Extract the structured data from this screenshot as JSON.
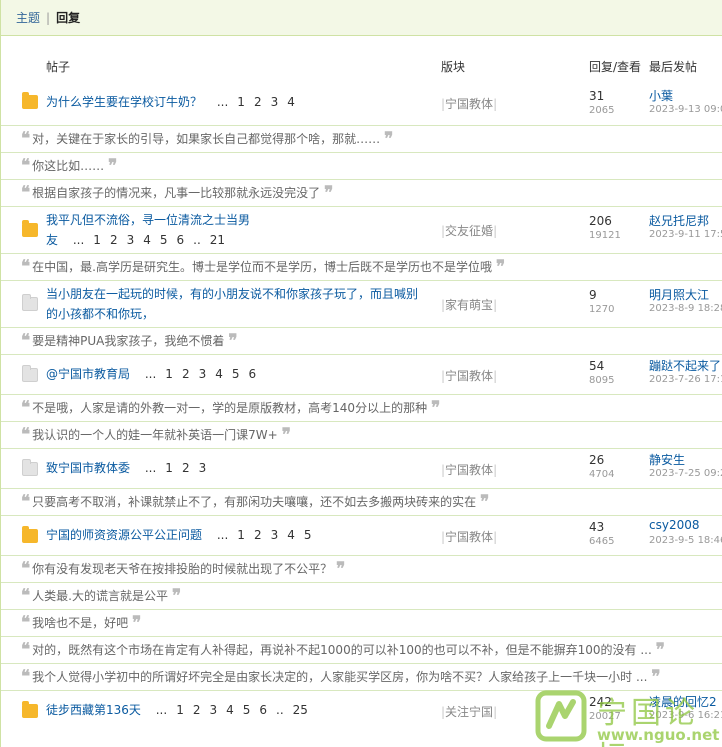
{
  "tabs": [
    {
      "label": "主题"
    },
    {
      "label": "回复"
    }
  ],
  "columns": {
    "post": "帖子",
    "forum": "版块",
    "replies_views": "回复/查看",
    "last_post": "最后发帖"
  },
  "threads": [
    {
      "title": "为什么学生要在学校订牛奶？",
      "ellipsis": "...",
      "pages": [
        "1",
        "2",
        "3",
        "4"
      ],
      "forum": "宁国教体",
      "replies": "31",
      "views": "2065",
      "last_user": "小葉",
      "last_date": "2023-9-13 09:0",
      "icon": "hot",
      "quotes": [
        "对，关键在于家长的引导，如果家长自己都觉得那个啥，那就……",
        "你这比如……",
        "根据自家孩子的情况来，凡事一比较那就永远没完没了"
      ]
    },
    {
      "title": "我平凡但不流俗，寻一位清流之士当男友",
      "title_line1": "我平凡但不流俗，寻一位清流之士当男",
      "title_line2": "友",
      "ellipsis": "...",
      "pages": [
        "1",
        "2",
        "3",
        "4",
        "5",
        "6",
        "..",
        "21"
      ],
      "forum": "交友征婚",
      "replies": "206",
      "views": "19121",
      "last_user": "赵兄托尼邦",
      "last_date": "2023-9-11 17:5",
      "icon": "hot",
      "quotes": [
        "在中国，最.高学历是研究生。博士是学位而不是学历，博士后既不是学历也不是学位哦"
      ]
    },
    {
      "title_line1": "当小朋友在一起玩的时候，有的小朋友说不和你家孩子玩了，而且喊别",
      "title_line2": "的小孩都不和你玩，",
      "forum": "家有萌宝",
      "replies": "9",
      "views": "1270",
      "last_user": "明月照大江",
      "last_date": "2023-8-9 18:28",
      "icon": "cold",
      "quotes": [
        "要是精神PUA我家孩子，我绝不惯着"
      ]
    },
    {
      "title": "@宁国市教育局",
      "ellipsis": "...",
      "pages": [
        "1",
        "2",
        "3",
        "4",
        "5",
        "6"
      ],
      "forum": "宁国教体",
      "replies": "54",
      "views": "8095",
      "last_user": "蹦跶不起来了",
      "last_date": "2023-7-26 17:1",
      "icon": "cold",
      "quotes": [
        "不是哦，人家是请的外教一对一，学的是原版教材，高考140分以上的那种",
        "我认识的一个人的娃一年就补英语一门课7W+"
      ]
    },
    {
      "title": "致宁国市教体委",
      "ellipsis": "...",
      "pages": [
        "1",
        "2",
        "3"
      ],
      "forum": "宁国教体",
      "replies": "26",
      "views": "4704",
      "last_user": "静安生",
      "last_date": "2023-7-25 09:2",
      "icon": "cold",
      "quotes": [
        "只要高考不取消，补课就禁止不了，有那闲功夫嚷嚷，还不如去多搬两块砖来的实在"
      ]
    },
    {
      "title": "宁国的师资资源公平公正问题",
      "ellipsis": "...",
      "pages": [
        "1",
        "2",
        "3",
        "4",
        "5"
      ],
      "forum": "宁国教体",
      "replies": "43",
      "views": "6465",
      "last_user": "csy2008",
      "last_date": "2023-9-5 18:46",
      "icon": "hot",
      "quotes": [
        "你有没有发现老天爷在按排投胎的时候就出现了不公平？",
        "人类最.大的谎言就是公平",
        "我啥也不是，好吧",
        "对的，既然有这个市场在肯定有人补得起，再说补不起1000的可以补100的也可以不补，但是不能摒弃100的没有 ...",
        "我个人觉得小学初中的所谓好坏完全是由家长决定的，人家能买学区房，你为啥不买？人家给孩子上一千块一小时 ..."
      ]
    },
    {
      "title": "徒步西藏第136天",
      "ellipsis": "...",
      "pages": [
        "1",
        "2",
        "3",
        "4",
        "5",
        "6",
        "..",
        "25"
      ],
      "forum": "关注宁国",
      "replies": "242",
      "views": "20027",
      "last_user": "凌晨的回忆2",
      "last_date": "2023-9-6 16:21",
      "icon": "hot",
      "quotes": []
    }
  ],
  "watermark": {
    "name": "宁国论坛",
    "url": "www.nguo.net"
  },
  "colors": {
    "accent_green": "#8ec63f",
    "link_blue": "#0a5aa0",
    "border": "#d8e8bf",
    "tab_bg": "#f3f8e6"
  }
}
